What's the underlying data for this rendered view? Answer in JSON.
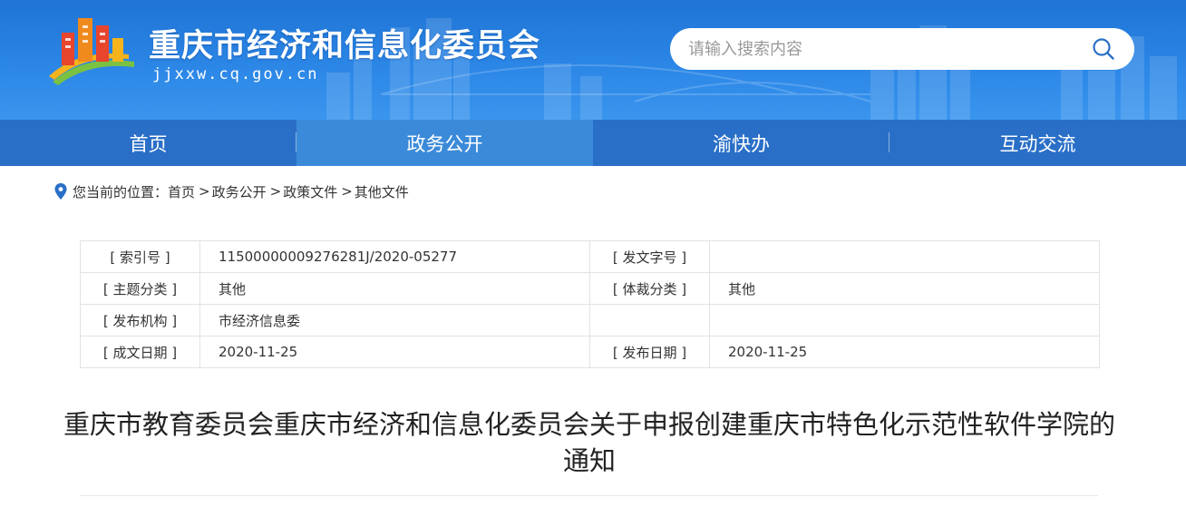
{
  "header": {
    "site_title": "重庆市经济和信息化委员会",
    "domain": "jjxxw.cq.gov.cn",
    "search_placeholder": "请输入搜索内容"
  },
  "nav": {
    "items": [
      {
        "label": "首页"
      },
      {
        "label": "政务公开"
      },
      {
        "label": "渝快办"
      },
      {
        "label": "互动交流"
      }
    ],
    "active": "政务公开"
  },
  "breadcrumb": {
    "prefix": "您当前的位置：",
    "items": [
      "首页",
      "政务公开",
      "政策文件",
      "其他文件"
    ],
    "separator": ">"
  },
  "info": {
    "index_label": "[ 索引号 ]",
    "index_value": "11500000009276281J/2020-05277",
    "doc_no_label": "[ 发文字号 ]",
    "doc_no_value": "",
    "topic_label": "[ 主题分类 ]",
    "topic_value": "其他",
    "genre_label": "[ 体裁分类 ]",
    "genre_value": "其他",
    "publisher_label": "[ 发布机构 ]",
    "publisher_value": "市经济信息委",
    "created_label": "[ 成文日期 ]",
    "created_value": "2020-11-25",
    "published_label": "[ 发布日期 ]",
    "published_value": "2020-11-25"
  },
  "article": {
    "title": "重庆市教育委员会重庆市经济和信息化委员会关于申报创建重庆市特色化示范性软件学院的通知"
  },
  "colors": {
    "header_blue": "#2b86e6",
    "nav_blue": "#2a6fc7",
    "nav_active": "#3b8ad9",
    "location_pin": "#2a6fc7"
  }
}
